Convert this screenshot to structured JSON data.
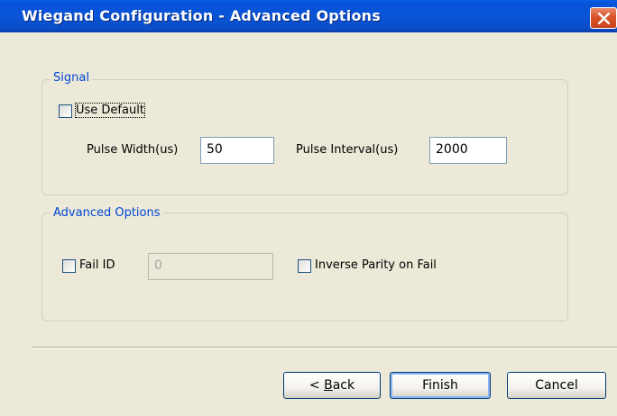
{
  "window": {
    "title": "Wiegand Configuration - Advanced Options"
  },
  "signal_group": {
    "legend": "Signal",
    "use_default_label": "Use Default",
    "use_default_checked": false,
    "pulse_width_label": "Pulse Width(us)",
    "pulse_width_value": "50",
    "pulse_interval_label": "Pulse Interval(us)",
    "pulse_interval_value": "2000"
  },
  "advanced_group": {
    "legend": "Advanced Options",
    "fail_id_label": "Fail ID",
    "fail_id_checked": false,
    "fail_id_value": "0",
    "inverse_parity_label": "Inverse Parity on Fail",
    "inverse_parity_checked": false
  },
  "buttons": {
    "back_prefix": "< ",
    "back_mnemonic": "B",
    "back_rest": "ack",
    "finish": "Finish",
    "cancel": "Cancel"
  },
  "colors": {
    "titlebar": "#0a55d6",
    "legend_text": "#0046d5",
    "dialog_bg": "#ece9d8"
  }
}
